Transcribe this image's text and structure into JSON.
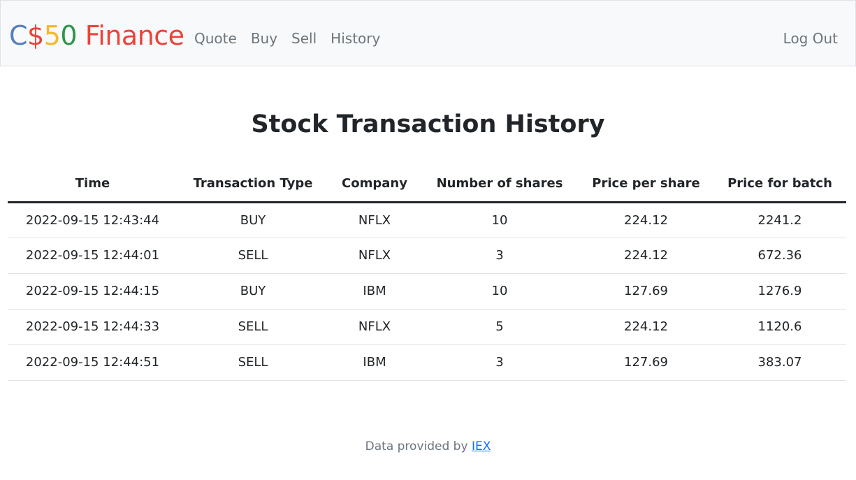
{
  "navbar": {
    "brand": {
      "part1": "C",
      "part2": "$",
      "part3": "5",
      "part4": "0",
      "part5": " Finance"
    },
    "links": [
      "Quote",
      "Buy",
      "Sell",
      "History"
    ],
    "logout": "Log Out"
  },
  "main": {
    "title": "Stock Transaction History",
    "table": {
      "headers": [
        "Time",
        "Transaction Type",
        "Company",
        "Number of shares",
        "Price per share",
        "Price for batch"
      ],
      "rows": [
        [
          "2022-09-15 12:43:44",
          "BUY",
          "NFLX",
          "10",
          "224.12",
          "2241.2"
        ],
        [
          "2022-09-15 12:44:01",
          "SELL",
          "NFLX",
          "3",
          "224.12",
          "672.36"
        ],
        [
          "2022-09-15 12:44:15",
          "BUY",
          "IBM",
          "10",
          "127.69",
          "1276.9"
        ],
        [
          "2022-09-15 12:44:33",
          "SELL",
          "NFLX",
          "5",
          "224.12",
          "1120.6"
        ],
        [
          "2022-09-15 12:44:51",
          "SELL",
          "IBM",
          "3",
          "127.69",
          "383.07"
        ]
      ]
    }
  },
  "footer": {
    "text": "Data provided by ",
    "link": "IEX"
  },
  "colors": {
    "brand_blue": "#537fbe",
    "brand_red": "#ea433b",
    "brand_yellow": "#f5b82e",
    "brand_green": "#2e944b",
    "nav_text": "#6c757d",
    "link": "#0d6efd"
  }
}
